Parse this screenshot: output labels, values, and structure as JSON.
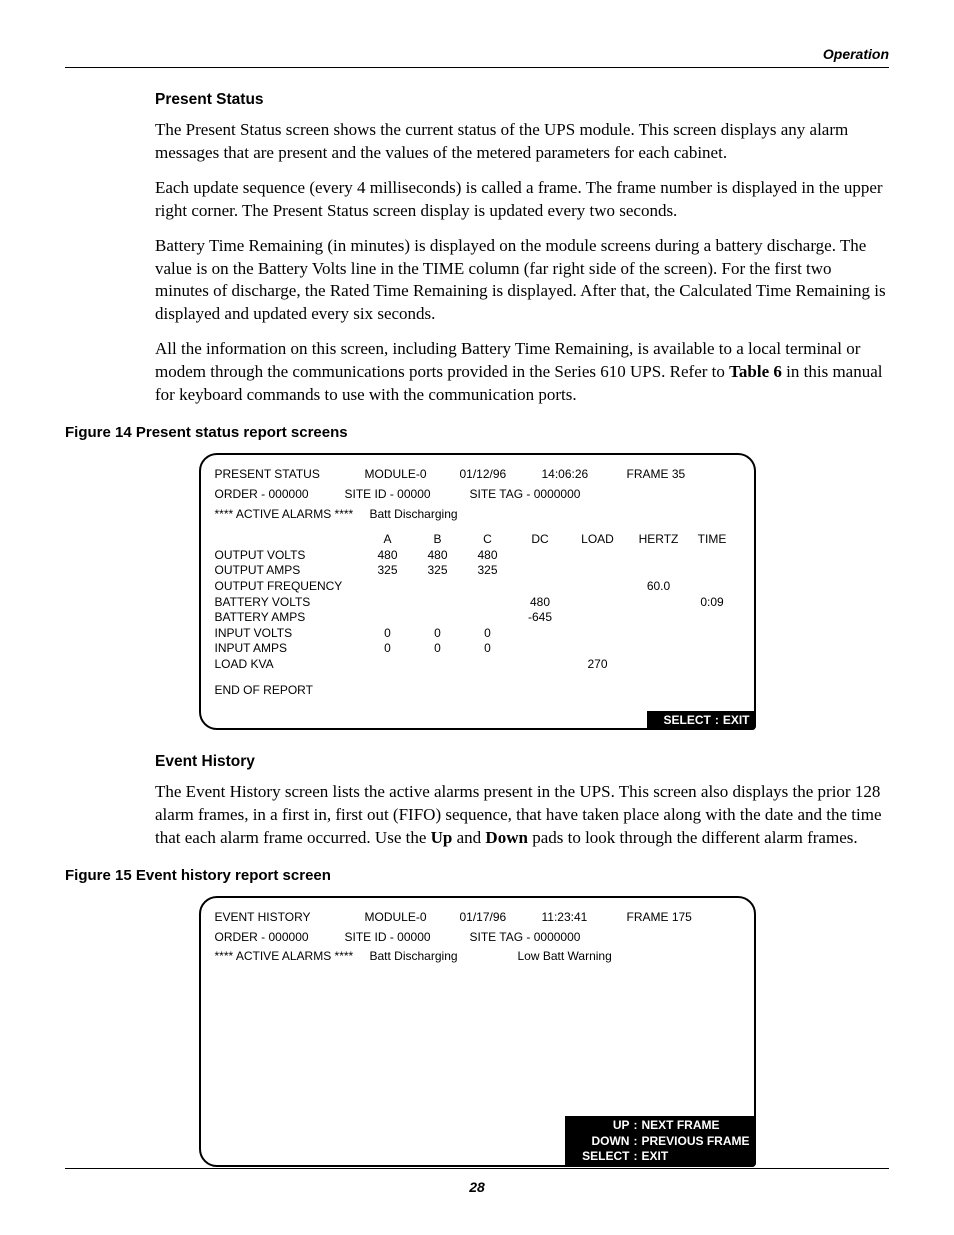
{
  "runningHead": "Operation",
  "section1": {
    "title": "Present Status",
    "p1": "The Present Status screen shows the current status of the UPS module. This screen displays any alarm messages that are present and the values of the metered parameters for each cabinet.",
    "p2": "Each update sequence (every 4 milliseconds) is called a frame. The frame number is displayed in the upper right corner. The Present Status screen display is updated every two seconds.",
    "p3": "Battery Time Remaining (in minutes) is displayed on the module screens during a battery discharge. The value is on the Battery Volts line in the TIME column (far right side of the screen). For the first two minutes of discharge, the Rated Time Remaining is displayed. After that, the Calculated Time Remaining is displayed and updated every six seconds.",
    "p4a": "All the information on this screen, including Battery Time Remaining, is available to a local terminal or modem through the communications ports provided in the Series 610 UPS. Refer to ",
    "p4ref": "Table 6",
    "p4b": " in this manual for keyboard commands to use with the communication ports.",
    "figCaption": "Figure 14  Present status report screens",
    "screen": {
      "title": "PRESENT STATUS",
      "module": "MODULE-0",
      "date": "01/12/96",
      "time": "14:06:26",
      "frame": "FRAME 35",
      "order": "ORDER - 000000",
      "site": "SITE  ID - 00000",
      "tag": "SITE TAG - 0000000",
      "alarmsLabel": "**** ACTIVE ALARMS ****",
      "alarm1": "Batt Discharging",
      "cols": [
        "",
        "A",
        "B",
        "C",
        "DC",
        "LOAD",
        "HERTZ",
        "TIME"
      ],
      "rows": [
        {
          "label": "OUTPUT VOLTS",
          "A": "480",
          "B": "480",
          "C": "480",
          "DC": "",
          "LOAD": "",
          "HERTZ": "",
          "TIME": ""
        },
        {
          "label": "OUTPUT AMPS",
          "A": "325",
          "B": "325",
          "C": "325",
          "DC": "",
          "LOAD": "",
          "HERTZ": "",
          "TIME": ""
        },
        {
          "label": "OUTPUT FREQUENCY",
          "A": "",
          "B": "",
          "C": "",
          "DC": "",
          "LOAD": "",
          "HERTZ": "60.0",
          "TIME": ""
        },
        {
          "label": "BATTERY VOLTS",
          "A": "",
          "B": "",
          "C": "",
          "DC": "480",
          "LOAD": "",
          "HERTZ": "",
          "TIME": "0:09"
        },
        {
          "label": "BATTERY AMPS",
          "A": "",
          "B": "",
          "C": "",
          "DC": "-645",
          "LOAD": "",
          "HERTZ": "",
          "TIME": ""
        },
        {
          "label": "INPUT VOLTS",
          "A": "0",
          "B": "0",
          "C": "0",
          "DC": "",
          "LOAD": "",
          "HERTZ": "",
          "TIME": ""
        },
        {
          "label": "INPUT AMPS",
          "A": "0",
          "B": "0",
          "C": "0",
          "DC": "",
          "LOAD": "",
          "HERTZ": "",
          "TIME": ""
        },
        {
          "label": "LOAD KVA",
          "A": "",
          "B": "",
          "C": "",
          "DC": "",
          "LOAD": "270",
          "HERTZ": "",
          "TIME": ""
        }
      ],
      "endOfReport": "END OF REPORT",
      "hints": [
        {
          "key": "SELECT",
          "action": "EXIT"
        }
      ]
    }
  },
  "section2": {
    "title": "Event History",
    "p1a": "The Event History screen lists the active alarms present in the UPS. This screen also displays the prior 128 alarm frames, in a first in, first out (FIFO) sequence, that have taken place along with the date and the time that each alarm frame occurred. Use the ",
    "up": "Up",
    "mid": " and ",
    "down": "Down",
    "p1b": " pads to look through the different alarm frames.",
    "figCaption": "Figure 15  Event history report screen",
    "screen": {
      "title": "EVENT HISTORY",
      "module": "MODULE-0",
      "date": "01/17/96",
      "time": "11:23:41",
      "frame": "FRAME 175",
      "order": "ORDER - 000000",
      "site": "SITE  ID - 00000",
      "tag": "SITE TAG - 0000000",
      "alarmsLabel": "**** ACTIVE ALARMS ****",
      "alarm1": "Batt Discharging",
      "alarm2": "Low Batt Warning",
      "hints": [
        {
          "key": "UP",
          "action": "NEXT FRAME"
        },
        {
          "key": "DOWN",
          "action": "PREVIOUS FRAME"
        },
        {
          "key": "SELECT",
          "action": "EXIT"
        }
      ]
    }
  },
  "pageNumber": "28"
}
